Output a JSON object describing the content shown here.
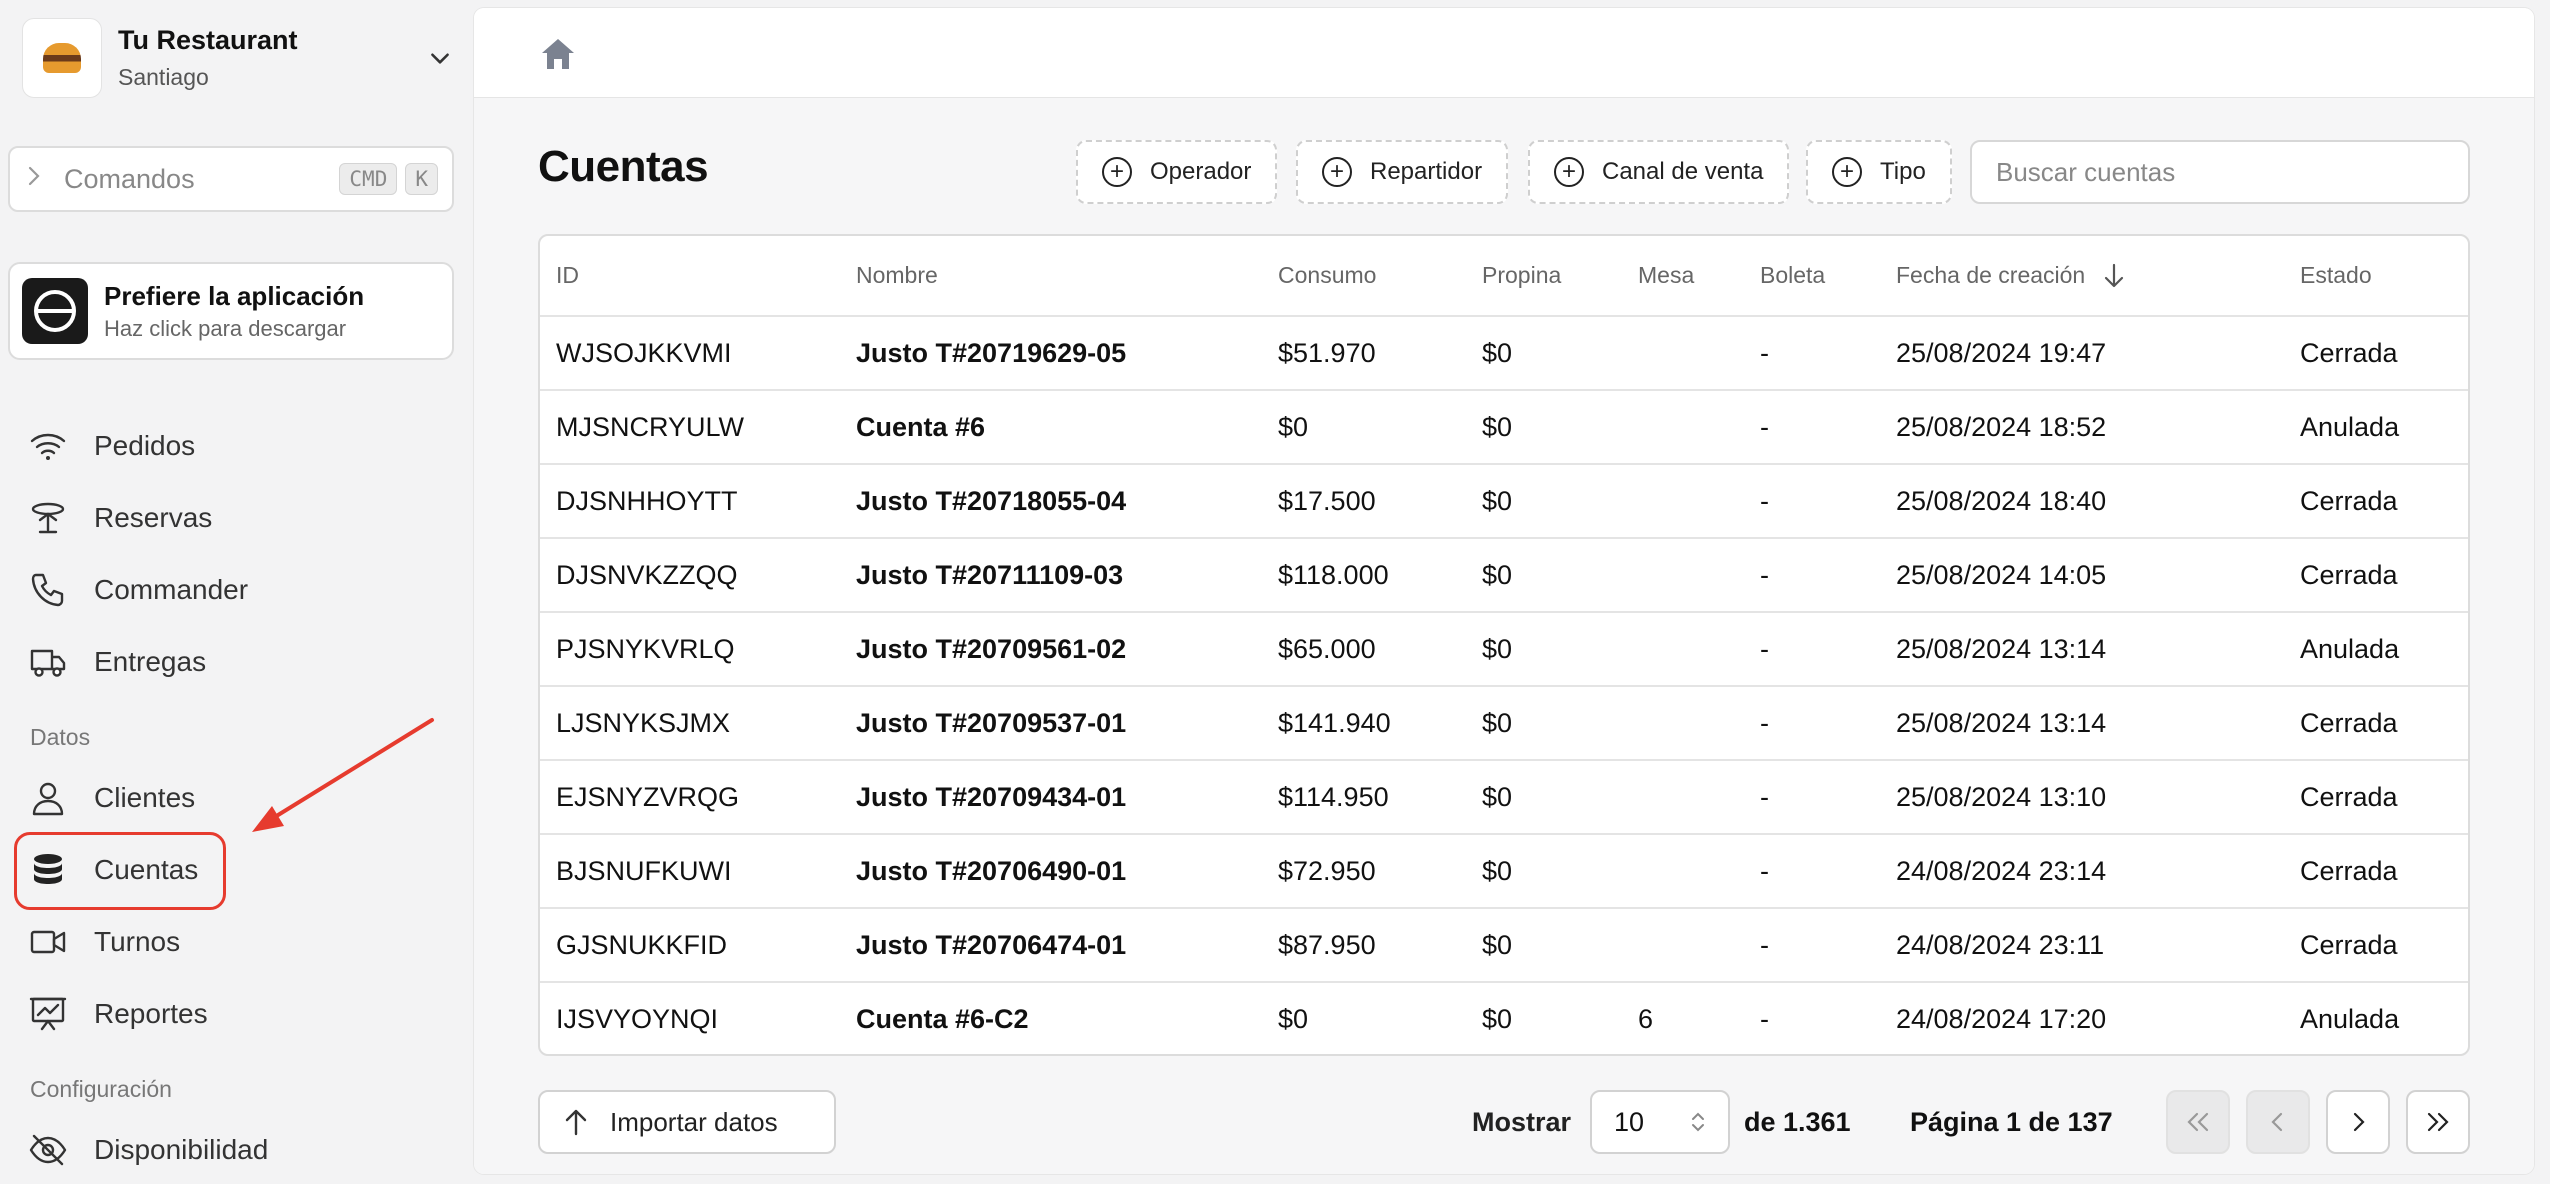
{
  "sidebar": {
    "restaurant_name": "Tu Restaurant",
    "city": "Santiago",
    "command": {
      "placeholder": "Comandos",
      "key1": "CMD",
      "key2": "K"
    },
    "app_promo": {
      "title": "Prefiere la aplicación",
      "subtitle": "Haz click para descargar"
    },
    "items": [
      {
        "label": "Pedidos",
        "icon": "wifi-icon"
      },
      {
        "label": "Reservas",
        "icon": "table-icon"
      },
      {
        "label": "Commander",
        "icon": "phone-icon"
      },
      {
        "label": "Entregas",
        "icon": "truck-icon"
      }
    ],
    "section_datos": "Datos",
    "datos_items": [
      {
        "label": "Clientes",
        "icon": "user-icon"
      },
      {
        "label": "Cuentas",
        "icon": "database-icon",
        "active": true
      },
      {
        "label": "Turnos",
        "icon": "video-icon"
      },
      {
        "label": "Reportes",
        "icon": "chart-board-icon"
      }
    ],
    "section_config": "Configuración",
    "config_items": [
      {
        "label": "Disponibilidad",
        "icon": "eye-off-icon"
      }
    ]
  },
  "main": {
    "title": "Cuentas",
    "filters": [
      "Operador",
      "Repartidor",
      "Canal de venta",
      "Tipo"
    ],
    "search_placeholder": "Buscar cuentas",
    "table": {
      "columns": [
        "ID",
        "Nombre",
        "Consumo",
        "Propina",
        "Mesa",
        "Boleta",
        "Fecha de creación",
        "Estado"
      ],
      "rows": [
        [
          "WJSOJKKVMI",
          "Justo T#20719629-05",
          "$51.970",
          "$0",
          "",
          "-",
          "25/08/2024 19:47",
          "Cerrada"
        ],
        [
          "MJSNCRYULW",
          "Cuenta #6",
          "$0",
          "$0",
          "",
          "-",
          "25/08/2024 18:52",
          "Anulada"
        ],
        [
          "DJSNHHOYTT",
          "Justo T#20718055-04",
          "$17.500",
          "$0",
          "",
          "-",
          "25/08/2024 18:40",
          "Cerrada"
        ],
        [
          "DJSNVKZZQQ",
          "Justo T#20711109-03",
          "$118.000",
          "$0",
          "",
          "-",
          "25/08/2024 14:05",
          "Cerrada"
        ],
        [
          "PJSNYKVRLQ",
          "Justo T#20709561-02",
          "$65.000",
          "$0",
          "",
          "-",
          "25/08/2024 13:14",
          "Anulada"
        ],
        [
          "LJSNYKSJMX",
          "Justo T#20709537-01",
          "$141.940",
          "$0",
          "",
          "-",
          "25/08/2024 13:14",
          "Cerrada"
        ],
        [
          "EJSNYZVRQG",
          "Justo T#20709434-01",
          "$114.950",
          "$0",
          "",
          "-",
          "25/08/2024 13:10",
          "Cerrada"
        ],
        [
          "BJSNUFKUWI",
          "Justo T#20706490-01",
          "$72.950",
          "$0",
          "",
          "-",
          "24/08/2024 23:14",
          "Cerrada"
        ],
        [
          "GJSNUKKFID",
          "Justo T#20706474-01",
          "$87.950",
          "$0",
          "",
          "-",
          "24/08/2024 23:11",
          "Cerrada"
        ],
        [
          "IJSVYOYNQI",
          "Cuenta #6-C2",
          "$0",
          "$0",
          "6",
          "-",
          "24/08/2024 17:20",
          "Anulada"
        ]
      ]
    },
    "import_label": "Importar datos",
    "pagination": {
      "show_label": "Mostrar",
      "page_size": "10",
      "total": "de 1.361",
      "page_info": "Página 1 de 137"
    }
  },
  "colors": {
    "highlight": "#e63b2e",
    "text": "#111111",
    "muted": "#888888"
  }
}
